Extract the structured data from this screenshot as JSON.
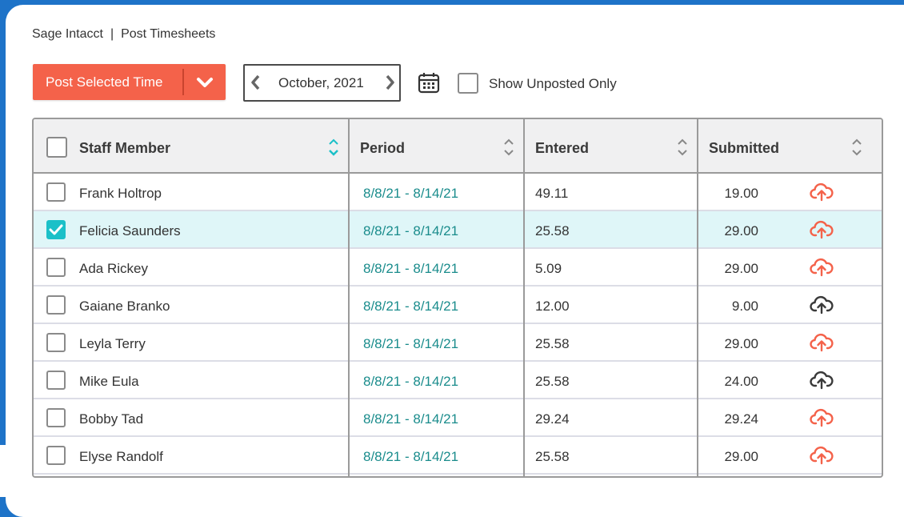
{
  "breadcrumb": {
    "app": "Sage Intacct",
    "separator": "|",
    "page": "Post Timesheets"
  },
  "toolbar": {
    "post_button_label": "Post Selected Time",
    "date_value": "October, 2021",
    "show_unposted_label": "Show Unposted Only",
    "show_unposted_checked": false
  },
  "colors": {
    "accent": "#f4624a",
    "teal": "#1bc0c8",
    "link": "#1a8c8c",
    "frame": "#1e73c8"
  },
  "icons": {
    "dropdown": "chevron-down-icon",
    "prev": "chevron-left-icon",
    "next": "chevron-right-icon",
    "calendar": "calendar-icon",
    "sort": "sort-icon",
    "upload": "cloud-upload-icon"
  },
  "table": {
    "columns": [
      "Staff Member",
      "Period",
      "Entered",
      "Submitted"
    ],
    "rows": [
      {
        "name": "Frank Holtrop",
        "period": "8/8/21 - 8/14/21",
        "entered": "49.11",
        "submitted": "19.00",
        "checked": false,
        "upload_color": "#f4624a"
      },
      {
        "name": "Felicia Saunders",
        "period": "8/8/21 - 8/14/21",
        "entered": "25.58",
        "submitted": "29.00",
        "checked": true,
        "upload_color": "#f4624a"
      },
      {
        "name": "Ada Rickey",
        "period": "8/8/21 - 8/14/21",
        "entered": "5.09",
        "submitted": "29.00",
        "checked": false,
        "upload_color": "#f4624a"
      },
      {
        "name": "Gaiane Branko",
        "period": "8/8/21 - 8/14/21",
        "entered": "12.00",
        "submitted": "9.00",
        "checked": false,
        "upload_color": "#3a3a3a"
      },
      {
        "name": "Leyla Terry",
        "period": "8/8/21 - 8/14/21",
        "entered": "25.58",
        "submitted": "29.00",
        "checked": false,
        "upload_color": "#f4624a"
      },
      {
        "name": "Mike Eula",
        "period": "8/8/21 - 8/14/21",
        "entered": "25.58",
        "submitted": "24.00",
        "checked": false,
        "upload_color": "#3a3a3a"
      },
      {
        "name": "Bobby Tad",
        "period": "8/8/21 - 8/14/21",
        "entered": "29.24",
        "submitted": "29.24",
        "checked": false,
        "upload_color": "#f4624a"
      },
      {
        "name": "Elyse Randolf",
        "period": "8/8/21 - 8/14/21",
        "entered": "25.58",
        "submitted": "29.00",
        "checked": false,
        "upload_color": "#f4624a"
      }
    ]
  }
}
